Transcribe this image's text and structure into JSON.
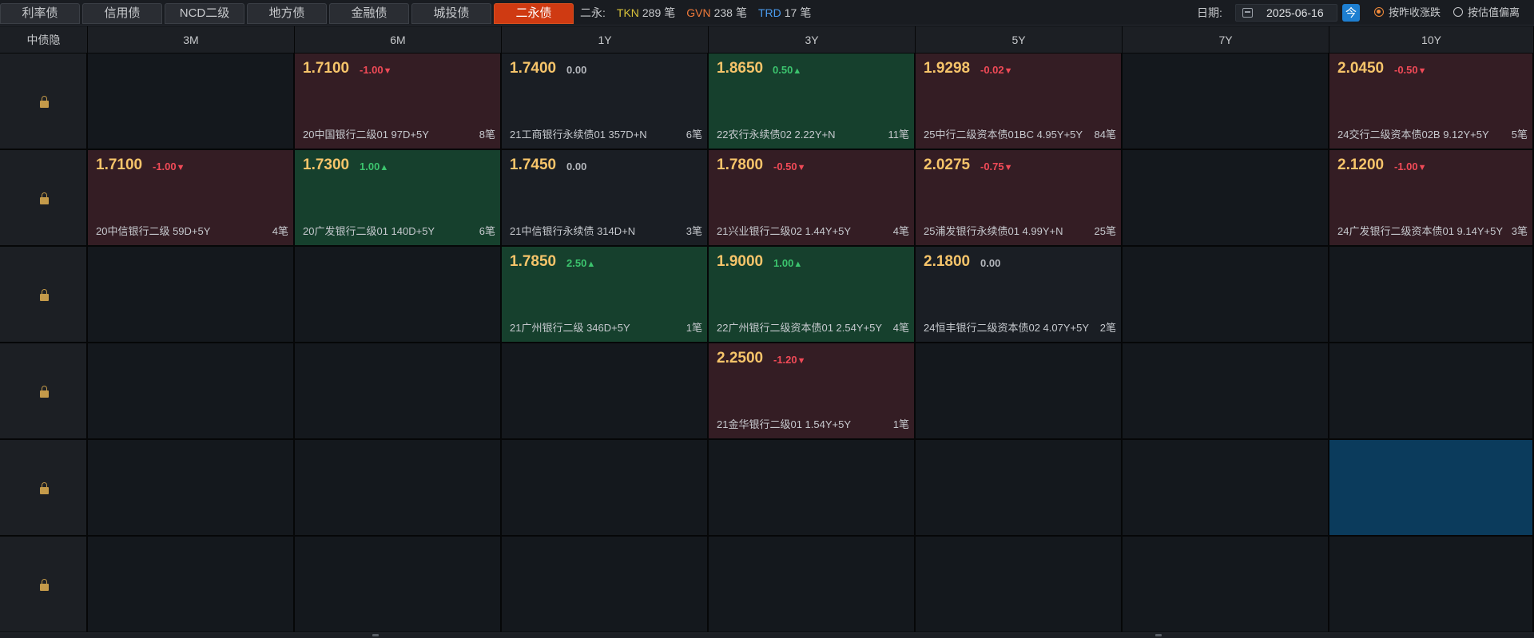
{
  "tabs": [
    {
      "label": "利率债",
      "active": false
    },
    {
      "label": "信用债",
      "active": false
    },
    {
      "label": "NCD二级",
      "active": false
    },
    {
      "label": "地方债",
      "active": false
    },
    {
      "label": "金融债",
      "active": false
    },
    {
      "label": "城投债",
      "active": false
    },
    {
      "label": "二永债",
      "active": true
    }
  ],
  "stats": {
    "prefix": "二永:",
    "items": [
      {
        "name": "TKN",
        "count": "289",
        "unit": "笔",
        "color": "#d8c23a"
      },
      {
        "name": "GVN",
        "count": "238",
        "unit": "笔",
        "color": "#f07a3a"
      },
      {
        "name": "TRD",
        "count": "17",
        "unit": "笔",
        "color": "#4a9cf0"
      }
    ]
  },
  "date": {
    "label": "日期:",
    "value": "2025-06-16",
    "today_label": "今"
  },
  "radios": [
    {
      "label": "按昨收涨跌",
      "checked": true
    },
    {
      "label": "按估值偏离",
      "checked": false
    }
  ],
  "grid": {
    "corner_label": "中债隐",
    "columns": [
      "3M",
      "6M",
      "1Y",
      "3Y",
      "5Y",
      "7Y",
      "10Y"
    ],
    "rows": [
      [
        null,
        {
          "yield": "1.7100",
          "change": "-1.00",
          "dir": "down",
          "bond": "20中国银行二级01 97D+5Y",
          "count": "8笔"
        },
        {
          "yield": "1.7400",
          "change": "0.00",
          "dir": "flat",
          "bond": "21工商银行永续债01 357D+N",
          "count": "6笔"
        },
        {
          "yield": "1.8650",
          "change": "0.50",
          "dir": "up",
          "bond": "22农行永续债02 2.22Y+N",
          "count": "11笔"
        },
        {
          "yield": "1.9298",
          "change": "-0.02",
          "dir": "down",
          "bond": "25中行二级资本债01BC 4.95Y+5Y",
          "count": "84笔"
        },
        null,
        {
          "yield": "2.0450",
          "change": "-0.50",
          "dir": "down",
          "bond": "24交行二级资本债02B 9.12Y+5Y",
          "count": "5笔"
        }
      ],
      [
        {
          "yield": "1.7100",
          "change": "-1.00",
          "dir": "down",
          "bond": "20中信银行二级 59D+5Y",
          "count": "4笔"
        },
        {
          "yield": "1.7300",
          "change": "1.00",
          "dir": "up",
          "bond": "20广发银行二级01 140D+5Y",
          "count": "6笔"
        },
        {
          "yield": "1.7450",
          "change": "0.00",
          "dir": "flat",
          "bond": "21中信银行永续债 314D+N",
          "count": "3笔"
        },
        {
          "yield": "1.7800",
          "change": "-0.50",
          "dir": "down",
          "bond": "21兴业银行二级02 1.44Y+5Y",
          "count": "4笔"
        },
        {
          "yield": "2.0275",
          "change": "-0.75",
          "dir": "down",
          "bond": "25浦发银行永续债01 4.99Y+N",
          "count": "25笔"
        },
        null,
        {
          "yield": "2.1200",
          "change": "-1.00",
          "dir": "down",
          "bond": "24广发银行二级资本债01 9.14Y+5Y",
          "count": "3笔"
        }
      ],
      [
        null,
        null,
        {
          "yield": "1.7850",
          "change": "2.50",
          "dir": "up",
          "bond": "21广州银行二级 346D+5Y",
          "count": "1笔"
        },
        {
          "yield": "1.9000",
          "change": "1.00",
          "dir": "up",
          "bond": "22广州银行二级资本债01 2.54Y+5Y",
          "count": "4笔"
        },
        {
          "yield": "2.1800",
          "change": "0.00",
          "dir": "flat",
          "bond": "24恒丰银行二级资本债02 4.07Y+5Y",
          "count": "2笔"
        },
        null,
        null
      ],
      [
        null,
        null,
        null,
        {
          "yield": "2.2500",
          "change": "-1.20",
          "dir": "down",
          "bond": "21金华银行二级01 1.54Y+5Y",
          "count": "1笔"
        },
        null,
        null,
        null
      ],
      [
        null,
        null,
        null,
        null,
        null,
        null,
        {
          "highlight": "blue"
        }
      ],
      [
        null,
        null,
        null,
        null,
        null,
        null,
        null
      ]
    ]
  }
}
